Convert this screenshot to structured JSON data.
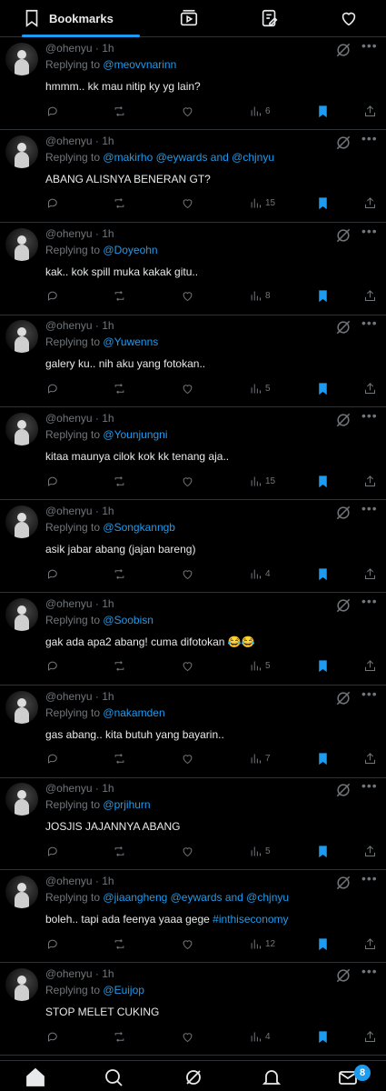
{
  "header": {
    "active_tab_label": "Bookmarks",
    "icons": [
      "bookmark-icon",
      "video-icon",
      "edit-list-icon",
      "heart-icon"
    ]
  },
  "tweets": [
    {
      "handle": "@ohenyu",
      "time": "1h",
      "replying_prefix": "Replying to",
      "mentions": "@meovvnarinn",
      "text": "hmmm.. kk mau nitip ky yg lain?",
      "views": "6"
    },
    {
      "handle": "@ohenyu",
      "time": "1h",
      "replying_prefix": "Replying to",
      "mentions": "@makirho @eywards and @chjnyu",
      "text": "ABANG ALISNYA BENERAN GT?",
      "views": "15"
    },
    {
      "handle": "@ohenyu",
      "time": "1h",
      "replying_prefix": "Replying to",
      "mentions": "@Doyeohn",
      "text": "kak.. kok spill muka kakak gitu..",
      "views": "8"
    },
    {
      "handle": "@ohenyu",
      "time": "1h",
      "replying_prefix": "Replying to",
      "mentions": "@Yuwenns",
      "text": "galery ku.. nih aku yang fotokan..",
      "views": "5"
    },
    {
      "handle": "@ohenyu",
      "time": "1h",
      "replying_prefix": "Replying to",
      "mentions": "@Younjungni",
      "text": "kitaa maunya cilok kok kk tenang aja..",
      "views": "15"
    },
    {
      "handle": "@ohenyu",
      "time": "1h",
      "replying_prefix": "Replying to",
      "mentions": "@Songkanngb",
      "text": "asik jabar abang (jajan bareng)",
      "views": "4"
    },
    {
      "handle": "@ohenyu",
      "time": "1h",
      "replying_prefix": "Replying to",
      "mentions": "@Soobisn",
      "text": "gak ada apa2 abang! cuma difotokan 😂😂",
      "views": "5"
    },
    {
      "handle": "@ohenyu",
      "time": "1h",
      "replying_prefix": "Replying to",
      "mentions": "@nakamden",
      "text": "gas abang.. kita butuh yang bayarin..",
      "views": "7"
    },
    {
      "handle": "@ohenyu",
      "time": "1h",
      "replying_prefix": "Replying to",
      "mentions": "@prjihurn",
      "text": "JOSJIS JAJANNYA ABANG",
      "views": "5"
    },
    {
      "handle": "@ohenyu",
      "time": "1h",
      "replying_prefix": "Replying to",
      "mentions": "@jiaangheng @eywards and @chjnyu",
      "text": "boleh.. tapi ada feenya yaaa gege ",
      "hashtag": "#inthiseconomy",
      "views": "12"
    },
    {
      "handle": "@ohenyu",
      "time": "1h",
      "replying_prefix": "Replying to",
      "mentions": "@Euijop",
      "text": "STOP MELET CUKING",
      "views": "4"
    }
  ],
  "bottom_nav": {
    "icons": [
      "home-icon",
      "search-icon",
      "grok-icon",
      "notifications-icon",
      "messages-icon"
    ],
    "messages_badge": "8"
  },
  "colors": {
    "accent": "#1d9bf0",
    "muted": "#71767b",
    "text": "#e7e9ea",
    "background": "#000000",
    "divider": "#2f3336"
  }
}
